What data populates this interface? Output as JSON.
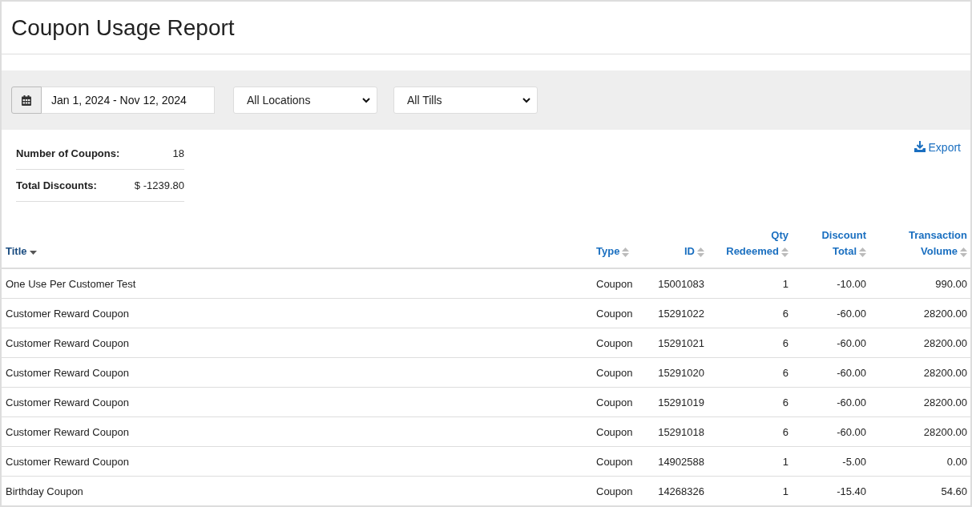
{
  "page": {
    "title": "Coupon Usage Report"
  },
  "filters": {
    "date_range": "Jan 1, 2024 - Nov 12, 2024",
    "location": "All Locations",
    "till": "All Tills"
  },
  "summary": [
    {
      "label": "Number of Coupons:",
      "value": "18"
    },
    {
      "label": "Total Discounts:",
      "value": "$ -1239.80"
    }
  ],
  "export": {
    "label": "Export"
  },
  "table": {
    "columns": [
      {
        "lines": [
          "Title"
        ],
        "sorted": true
      },
      {
        "lines": [
          "Type"
        ],
        "sorted": false
      },
      {
        "lines": [
          "ID"
        ],
        "sorted": false
      },
      {
        "lines": [
          "Qty",
          "Redeemed"
        ],
        "sorted": false
      },
      {
        "lines": [
          "Discount",
          "Total"
        ],
        "sorted": false
      },
      {
        "lines": [
          "Transaction",
          "Volume"
        ],
        "sorted": false
      }
    ],
    "rows": [
      [
        "One Use Per Customer Test",
        "Coupon",
        "15001083",
        "1",
        "-10.00",
        "990.00"
      ],
      [
        "Customer Reward Coupon",
        "Coupon",
        "15291022",
        "6",
        "-60.00",
        "28200.00"
      ],
      [
        "Customer Reward Coupon",
        "Coupon",
        "15291021",
        "6",
        "-60.00",
        "28200.00"
      ],
      [
        "Customer Reward Coupon",
        "Coupon",
        "15291020",
        "6",
        "-60.00",
        "28200.00"
      ],
      [
        "Customer Reward Coupon",
        "Coupon",
        "15291019",
        "6",
        "-60.00",
        "28200.00"
      ],
      [
        "Customer Reward Coupon",
        "Coupon",
        "15291018",
        "6",
        "-60.00",
        "28200.00"
      ],
      [
        "Customer Reward Coupon",
        "Coupon",
        "14902588",
        "1",
        "-5.00",
        "0.00"
      ],
      [
        "Birthday Coupon",
        "Coupon",
        "14268326",
        "1",
        "-15.40",
        "54.60"
      ]
    ]
  }
}
